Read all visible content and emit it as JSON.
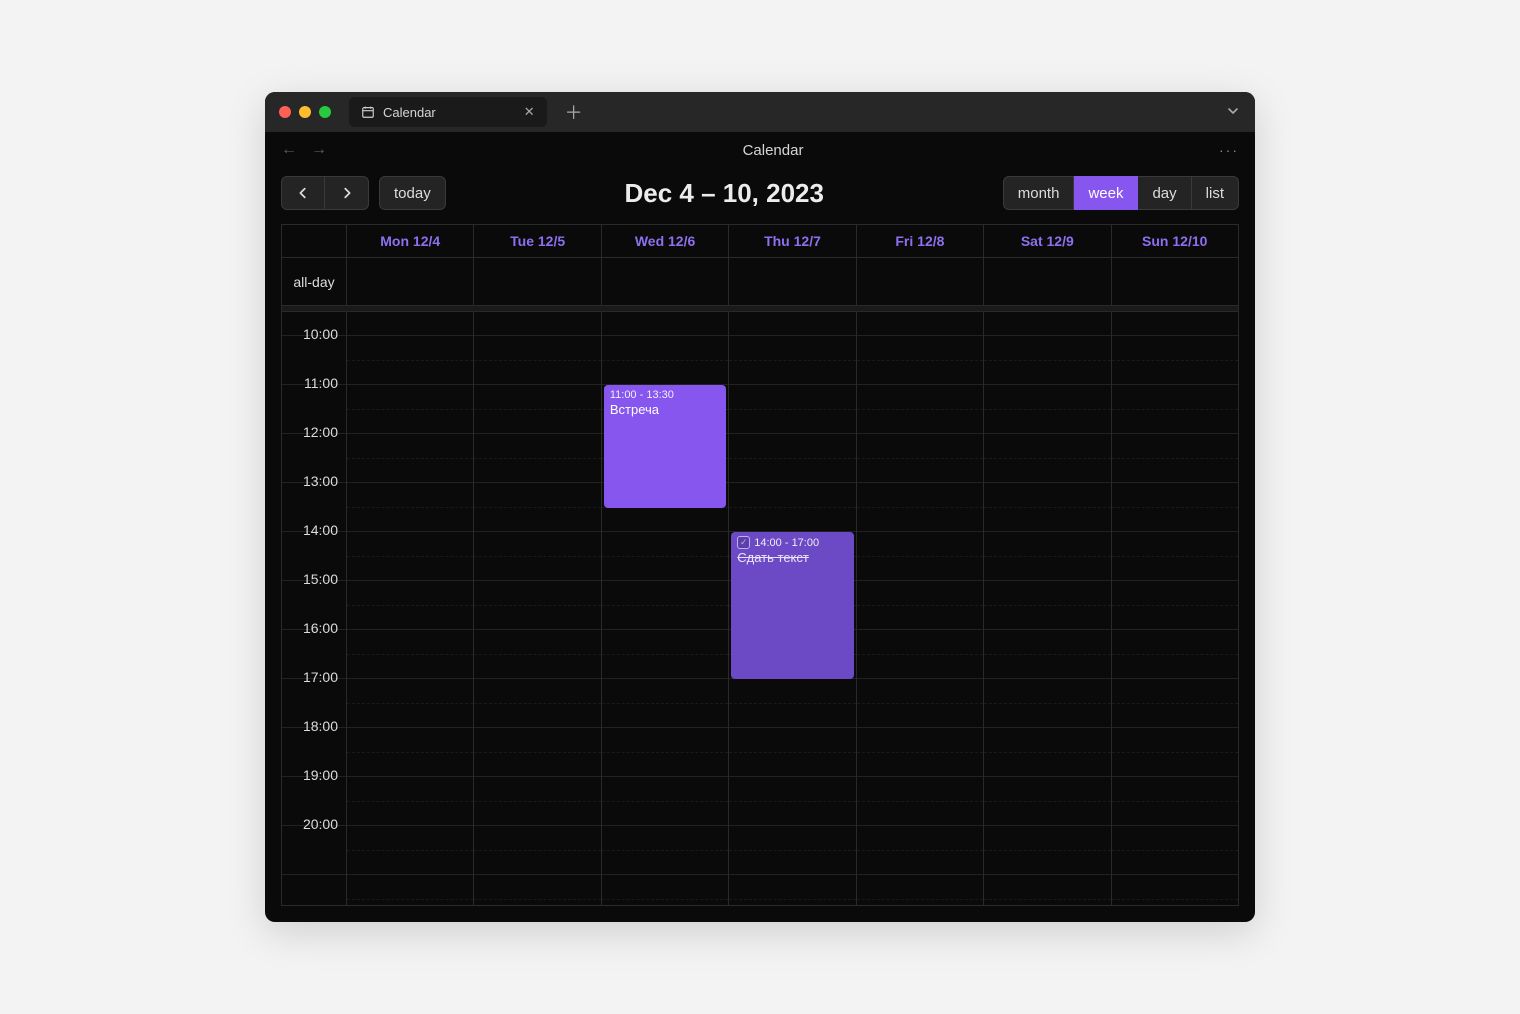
{
  "titlebar": {
    "tab_title": "Calendar"
  },
  "app_header": {
    "title": "Calendar"
  },
  "toolbar": {
    "today_label": "today",
    "date_range": "Dec 4 – 10, 2023",
    "views": {
      "month": "month",
      "week": "week",
      "day": "day",
      "list": "list",
      "active": "week"
    }
  },
  "calendar": {
    "allday_label": "all-day",
    "days": [
      {
        "label": "Mon 12/4"
      },
      {
        "label": "Tue 12/5"
      },
      {
        "label": "Wed 12/6"
      },
      {
        "label": "Thu 12/7"
      },
      {
        "label": "Fri 12/8"
      },
      {
        "label": "Sat 12/9"
      },
      {
        "label": "Sun 12/10"
      }
    ],
    "hours": [
      "10:00",
      "11:00",
      "12:00",
      "13:00",
      "14:00",
      "15:00",
      "16:00",
      "17:00",
      "18:00",
      "19:00",
      "20:00"
    ],
    "events": [
      {
        "day_index": 2,
        "time_label": "11:00 - 13:30",
        "title": "Встреча",
        "start": "11:00",
        "end": "13:30",
        "completed": false,
        "color": "#8656ee"
      },
      {
        "day_index": 3,
        "time_label": "14:00 - 17:00",
        "title": "Сдать текст",
        "start": "14:00",
        "end": "17:00",
        "completed": true,
        "color": "#6c49c5"
      }
    ]
  },
  "colors": {
    "accent": "#8656ee",
    "accent_dim": "#6c49c5",
    "day_header": "#8e6ff0"
  }
}
